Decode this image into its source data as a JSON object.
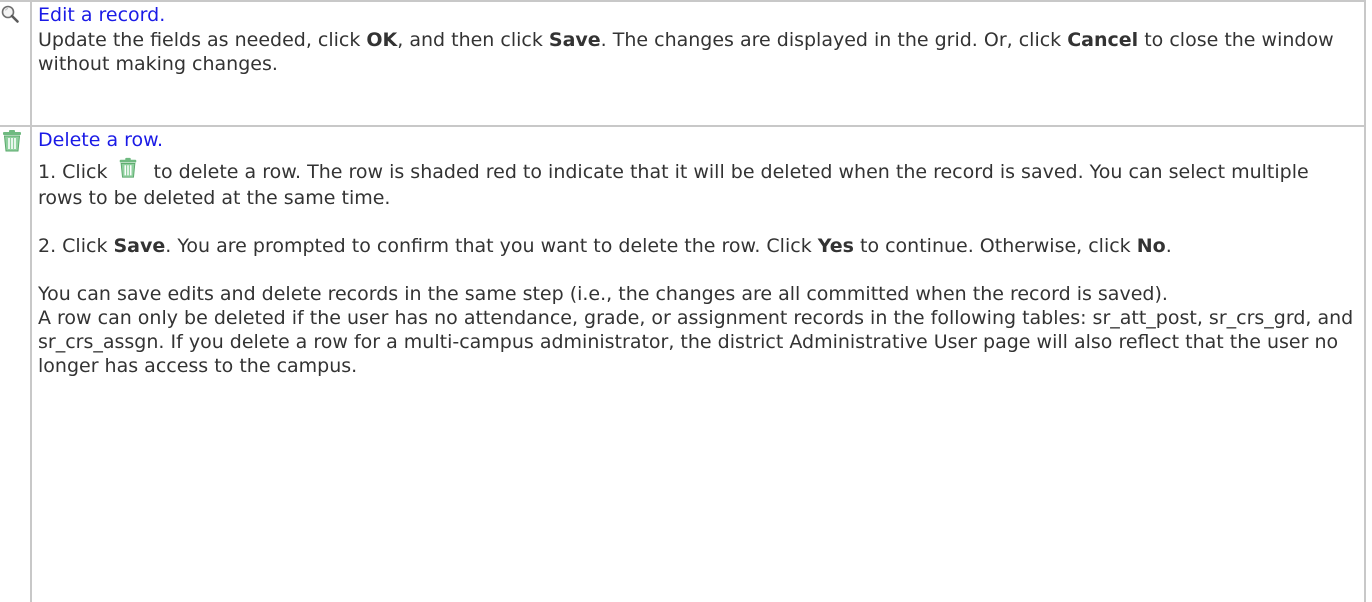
{
  "edit": {
    "icon": "magnifier-icon",
    "title": "Edit a record.",
    "text_1": "Update the fields as needed, click ",
    "bold_ok": "OK",
    "text_2": ", and then click ",
    "bold_save": "Save",
    "text_3": ". The changes are displayed in the grid. Or, click ",
    "bold_cancel": "Cancel",
    "text_4": " to close the window without making changes."
  },
  "delete": {
    "icon": "trash-icon",
    "title": "Delete a row.",
    "step1_a": "1. Click ",
    "step1_b": " to delete a row. The row is shaded red to indicate that it will be deleted when the record is saved. You can select multiple rows to be deleted at the same time.",
    "step2_a": "2. Click ",
    "step2_save": "Save",
    "step2_b": ". You are prompted to confirm that you want to delete the row. Click ",
    "step2_yes": "Yes",
    "step2_c": " to continue. Otherwise, click ",
    "step2_no": "No",
    "step2_d": ".",
    "note_1": "You can save edits and delete records in the same step (i.e., the changes are all committed when the record is saved).",
    "note_2": "A row can only be deleted if the user has no attendance, grade, or assignment records in the following tables: sr_att_post, sr_crs_grd, and sr_crs_assgn. If you delete a row for a multi-campus administrator, the district Administrative User page will also reflect that the user no longer has access to the campus."
  },
  "colors": {
    "link": "#1a1ae6",
    "text": "#333333",
    "border": "#c8c8c8",
    "trash": "#7fc38f"
  }
}
